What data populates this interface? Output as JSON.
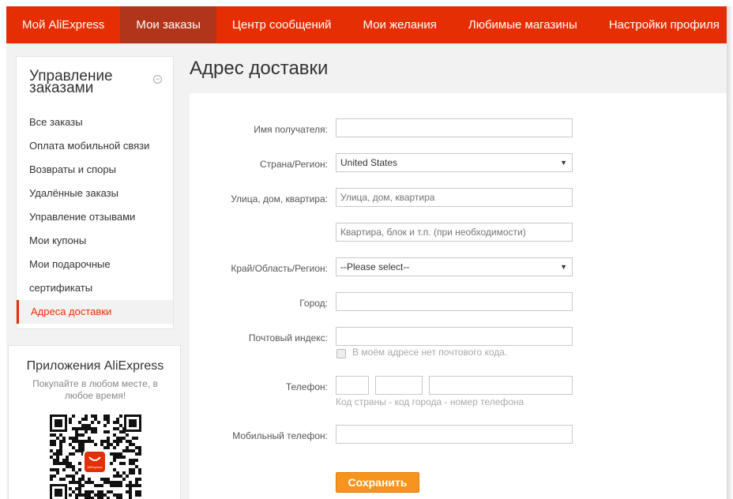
{
  "nav": {
    "items": [
      "Мой AliExpress",
      "Мои заказы",
      "Центр сообщений",
      "Мои желания",
      "Любимые магазины",
      "Настройки профиля"
    ],
    "active_index": 1
  },
  "sidebar": {
    "title": "Управление заказами",
    "items": [
      "Все заказы",
      "Оплата мобильной связи",
      "Возвраты и споры",
      "Удалённые заказы",
      "Управление отзывами",
      "Мои купоны",
      "Мои подарочные",
      "сертификаты",
      "Адреса доставки"
    ],
    "active_index": 8
  },
  "app_promo": {
    "title": "Приложения AliExpress",
    "subtitle": "Покупайте в любом месте, в любое время!",
    "logo_text": "AliExpress"
  },
  "page": {
    "title": "Адрес доставки"
  },
  "form": {
    "recipient_label": "Имя получателя:",
    "recipient_value": "",
    "country_label": "Страна/Регион:",
    "country_value": "United States",
    "street_label": "Улица, дом, квартира:",
    "street_placeholder": "Улица, дом, квартира",
    "apartment_placeholder": "Квартира, блок и т.п. (при необходимости)",
    "region_label": "Край/Область/Регион:",
    "region_value": "--Please select--",
    "city_label": "Город:",
    "city_value": "",
    "zip_label": "Почтовый индекс:",
    "zip_value": "",
    "no_zip_label": "В моём адресе нет почтового кода.",
    "no_zip_checked": false,
    "phone_label": "Телефон:",
    "phone_hint": "Код страны - код города - номер телефона",
    "mobile_label": "Мобильный телефон:",
    "mobile_value": "",
    "save_label": "Сохранить"
  },
  "colors": {
    "brand": "#e62e04",
    "nav_active": "#b0351a",
    "button": "#f7941d"
  }
}
